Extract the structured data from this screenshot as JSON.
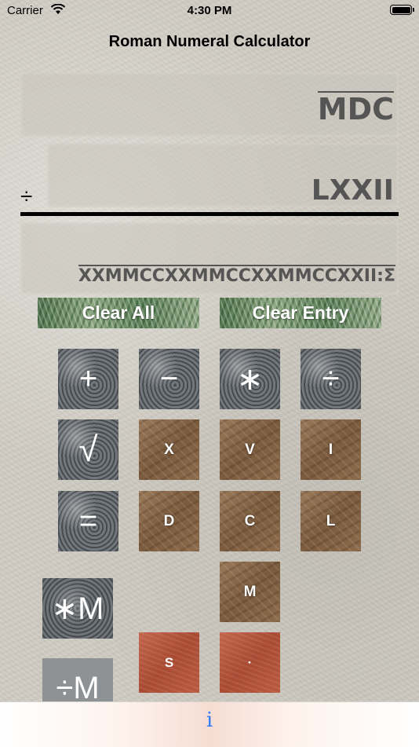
{
  "status_bar": {
    "carrier": "Carrier",
    "time": "4:30 PM"
  },
  "nav": {
    "title": "Roman Numeral Calculator"
  },
  "display": {
    "accumulator": "MDC",
    "operator": "÷",
    "entry": "LXXII",
    "result": "XXMMCCXXMMCCXXMMCCXXII:Σ"
  },
  "clear": {
    "all_label": "Clear All",
    "entry_label": "Clear Entry"
  },
  "keys": {
    "plus": "+",
    "minus": "−",
    "multiply": "∗",
    "divide": "÷",
    "sqrt": "√",
    "equals": "=",
    "x": "X",
    "v": "V",
    "i": "I",
    "d": "D",
    "c": "C",
    "l": "L",
    "m": "M",
    "s": "S",
    "dot": "·",
    "mem_mul": "∗M",
    "mem_div": "÷M"
  },
  "tab_bar": {
    "info": "i"
  }
}
